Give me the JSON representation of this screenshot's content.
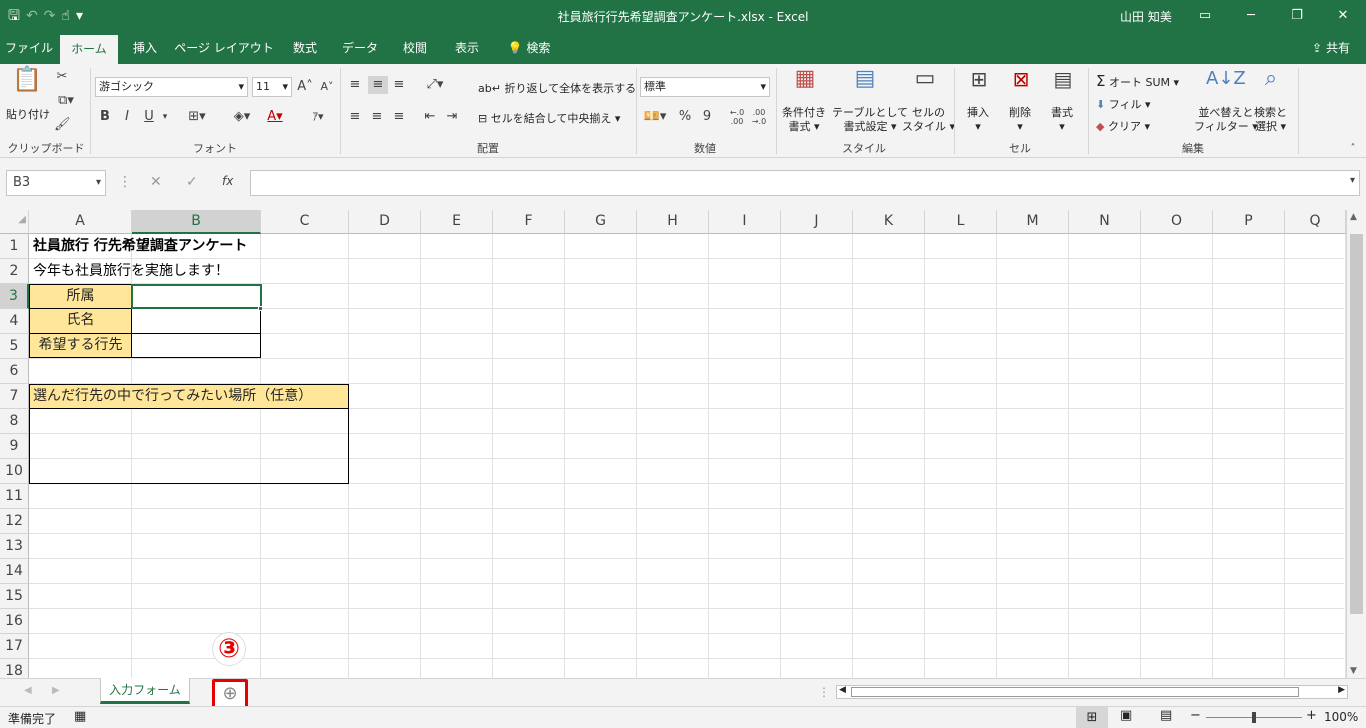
{
  "window": {
    "title": "社員旅行行先希望調査アンケート.xlsx  -  Excel",
    "user": "山田 知美",
    "minimize": "─",
    "restore": "❐",
    "close": "✕"
  },
  "qat": {
    "save": "🖫",
    "undo": "↶",
    "redo": "↷",
    "touch": "☝",
    "more": "▾"
  },
  "tabs": [
    {
      "label": "ファイル"
    },
    {
      "label": "ホーム"
    },
    {
      "label": "挿入"
    },
    {
      "label": "ページ レイアウト"
    },
    {
      "label": "数式"
    },
    {
      "label": "データ"
    },
    {
      "label": "校閲"
    },
    {
      "label": "表示"
    },
    {
      "label": "検索"
    }
  ],
  "share": "共有",
  "ribbon": {
    "clipboard": {
      "paste": "貼り付け",
      "label": "クリップボード"
    },
    "font": {
      "name": "游ゴシック",
      "size": "11",
      "bold": "B",
      "italic": "I",
      "underline": "U",
      "label": "フォント"
    },
    "alignment": {
      "wrap": "折り返して全体を表示する",
      "merge": "セルを結合して中央揃え",
      "label": "配置"
    },
    "number": {
      "format": "標準",
      "percent": "%",
      "comma": "9",
      "inc": "←.0 .00",
      "dec": ".00 →.0",
      "label": "数値"
    },
    "styles": {
      "cond": [
        "条件付き",
        "書式"
      ],
      "table": [
        "テーブルとして",
        "書式設定"
      ],
      "cell": [
        "セルの",
        "スタイル"
      ],
      "label": "スタイル"
    },
    "cells": {
      "insert": "挿入",
      "delete": "削除",
      "format": "書式",
      "label": "セル"
    },
    "editing": {
      "autosum": "オート SUM",
      "fill": "フィル",
      "clear": "クリア",
      "sort": [
        "並べ替えと",
        "フィルター"
      ],
      "find": [
        "検索と",
        "選択"
      ],
      "label": "編集"
    }
  },
  "formula_bar": {
    "name_box": "B3",
    "cancel": "✕",
    "enter": "✓",
    "fx": "fx",
    "value": ""
  },
  "columns": [
    "A",
    "B",
    "C",
    "D",
    "E",
    "F",
    "G",
    "H",
    "I",
    "J",
    "K",
    "L",
    "M",
    "N",
    "O",
    "P",
    "Q"
  ],
  "rows": [
    "1",
    "2",
    "3",
    "4",
    "5",
    "6",
    "7",
    "8",
    "9",
    "10",
    "11",
    "12",
    "13",
    "14",
    "15",
    "16",
    "17",
    "18"
  ],
  "cells": {
    "A1": "社員旅行 行先希望調査アンケート",
    "A2": "今年も社員旅行を実施します！",
    "A3": "所属",
    "A4": "氏名",
    "A5": "希望する行先",
    "A7": "選んだ行先の中で行ってみたい場所（任意）"
  },
  "sheets": [
    {
      "name": "入力フォーム"
    }
  ],
  "add_sheet": "⊕",
  "callout": "③",
  "status": {
    "ready": "準備完了",
    "zoom": "100%"
  },
  "colors": {
    "accent": "#217346",
    "label_fill": "#ffe699",
    "callout": "#e60000"
  }
}
